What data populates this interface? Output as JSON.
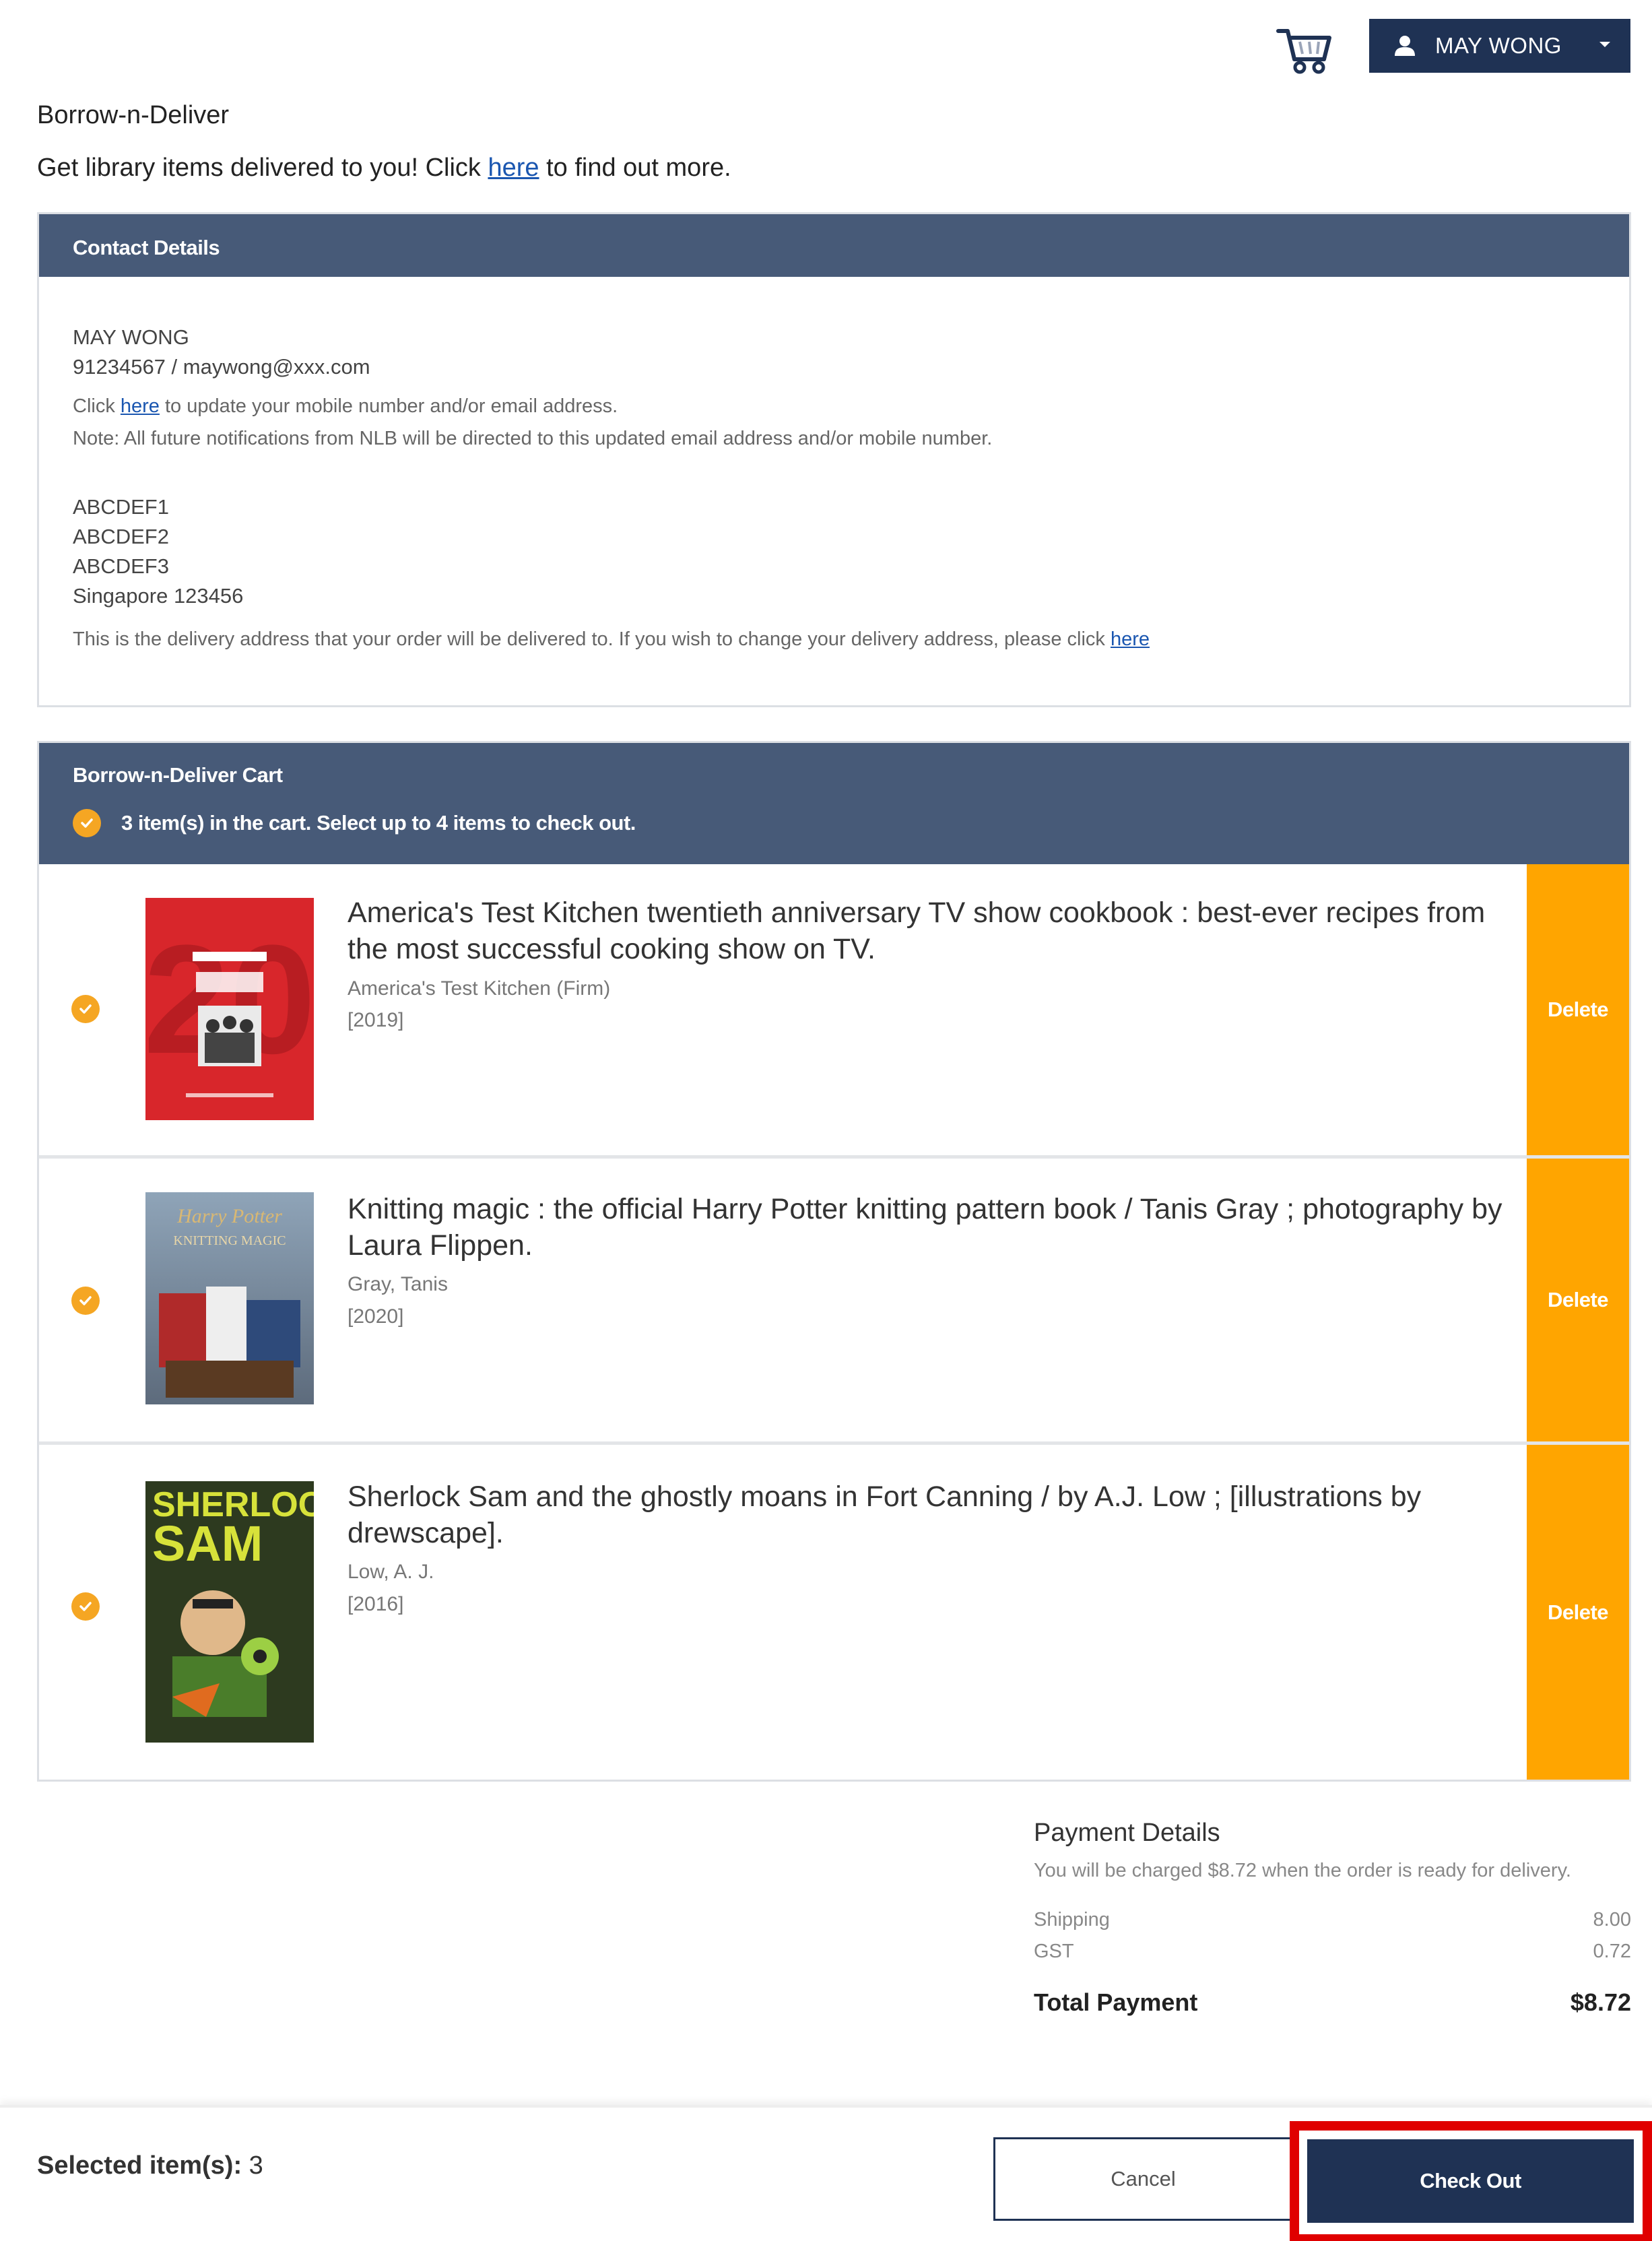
{
  "header": {
    "user_name": "MAY WONG",
    "cart_icon": "shopping-cart-icon",
    "user_icon": "person-icon"
  },
  "page": {
    "title": "Borrow-n-Deliver",
    "intro_before": "Get library items delivered to you! Click ",
    "intro_link": "here",
    "intro_after": " to find out more."
  },
  "contact": {
    "heading": "Contact Details",
    "name": "MAY WONG",
    "phone_email": "91234567 / maywong@xxx.com",
    "update_before": "Click ",
    "update_link": "here",
    "update_after": " to update your mobile number and/or email address.",
    "note": "Note: All future notifications from NLB will be directed to this updated email address and/or mobile number.",
    "address": [
      "ABCDEF1",
      "ABCDEF2",
      "ABCDEF3",
      "Singapore 123456"
    ],
    "delivery_note": "This is the delivery address that your order will be delivered to. If you wish to change your delivery address, please click ",
    "delivery_link": "here"
  },
  "cart": {
    "heading": "Borrow-n-Deliver Cart",
    "summary": "3 item(s) in the cart. Select up to 4 items to check out.",
    "delete_label": "Delete",
    "items": [
      {
        "title": "America's Test Kitchen twentieth anniversary TV show cookbook : best-ever recipes from the most successful cooking show on TV.",
        "author": "America's Test Kitchen (Firm)",
        "year": "[2019]"
      },
      {
        "title": "Knitting magic : the official Harry Potter knitting pattern book / Tanis Gray ; photography by Laura Flippen.",
        "author": "Gray, Tanis",
        "year": "[2020]"
      },
      {
        "title": "Sherlock Sam and the ghostly moans in Fort Canning / by A.J. Low ; [illustrations by drewscape].",
        "author": "Low, A. J.",
        "year": "[2016]"
      }
    ]
  },
  "payment": {
    "heading": "Payment Details",
    "note": "You will be charged $8.72 when the order is ready for delivery.",
    "shipping_label": "Shipping",
    "shipping_value": "8.00",
    "gst_label": "GST",
    "gst_value": "0.72",
    "total_label": "Total Payment",
    "total_value": "$8.72"
  },
  "footer": {
    "selected_label": "Selected item(s):",
    "selected_count": "3",
    "cancel_label": "Cancel",
    "checkout_label": "Check Out"
  },
  "colors": {
    "navy": "#1f3254",
    "panel_header": "#475a78",
    "accent_orange": "#ffa500",
    "link_blue": "#1a56b0",
    "highlight_red": "#e00000"
  }
}
